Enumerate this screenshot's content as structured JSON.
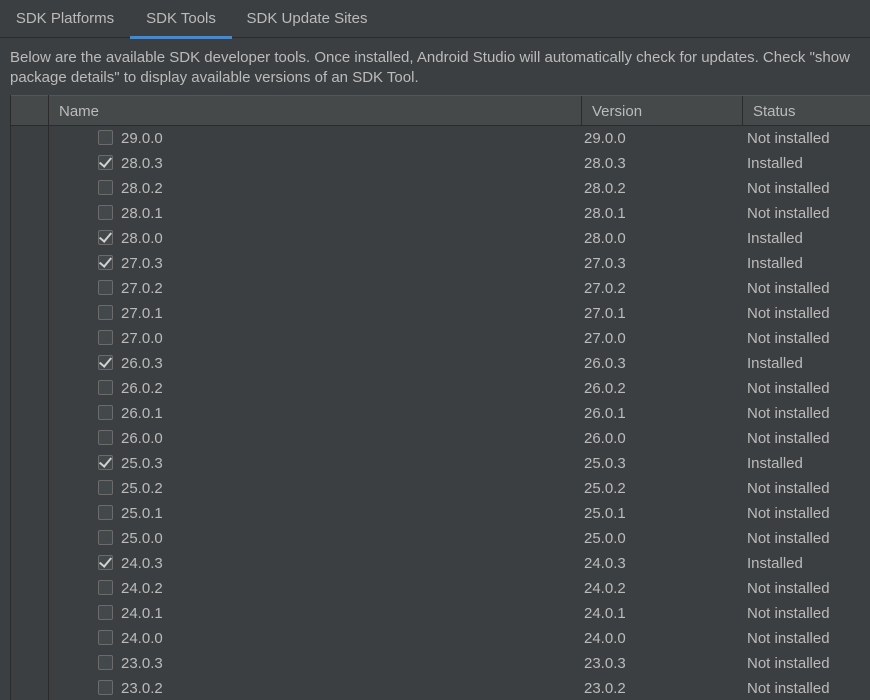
{
  "tabs": [
    {
      "label": "SDK Platforms",
      "active": false
    },
    {
      "label": "SDK Tools",
      "active": true
    },
    {
      "label": "SDK Update Sites",
      "active": false
    }
  ],
  "description": "Below are the available SDK developer tools. Once installed, Android Studio will automatically check for updates. Check \"show package details\" to display available versions of an SDK Tool.",
  "table": {
    "columns": {
      "name": "Name",
      "version": "Version",
      "status": "Status"
    },
    "rows": [
      {
        "name": "29.0.0",
        "version": "29.0.0",
        "status": "Not installed",
        "checked": false
      },
      {
        "name": "28.0.3",
        "version": "28.0.3",
        "status": "Installed",
        "checked": true
      },
      {
        "name": "28.0.2",
        "version": "28.0.2",
        "status": "Not installed",
        "checked": false
      },
      {
        "name": "28.0.1",
        "version": "28.0.1",
        "status": "Not installed",
        "checked": false
      },
      {
        "name": "28.0.0",
        "version": "28.0.0",
        "status": "Installed",
        "checked": true
      },
      {
        "name": "27.0.3",
        "version": "27.0.3",
        "status": "Installed",
        "checked": true
      },
      {
        "name": "27.0.2",
        "version": "27.0.2",
        "status": "Not installed",
        "checked": false
      },
      {
        "name": "27.0.1",
        "version": "27.0.1",
        "status": "Not installed",
        "checked": false
      },
      {
        "name": "27.0.0",
        "version": "27.0.0",
        "status": "Not installed",
        "checked": false
      },
      {
        "name": "26.0.3",
        "version": "26.0.3",
        "status": "Installed",
        "checked": true
      },
      {
        "name": "26.0.2",
        "version": "26.0.2",
        "status": "Not installed",
        "checked": false
      },
      {
        "name": "26.0.1",
        "version": "26.0.1",
        "status": "Not installed",
        "checked": false
      },
      {
        "name": "26.0.0",
        "version": "26.0.0",
        "status": "Not installed",
        "checked": false
      },
      {
        "name": "25.0.3",
        "version": "25.0.3",
        "status": "Installed",
        "checked": true
      },
      {
        "name": "25.0.2",
        "version": "25.0.2",
        "status": "Not installed",
        "checked": false
      },
      {
        "name": "25.0.1",
        "version": "25.0.1",
        "status": "Not installed",
        "checked": false
      },
      {
        "name": "25.0.0",
        "version": "25.0.0",
        "status": "Not installed",
        "checked": false
      },
      {
        "name": "24.0.3",
        "version": "24.0.3",
        "status": "Installed",
        "checked": true
      },
      {
        "name": "24.0.2",
        "version": "24.0.2",
        "status": "Not installed",
        "checked": false
      },
      {
        "name": "24.0.1",
        "version": "24.0.1",
        "status": "Not installed",
        "checked": false
      },
      {
        "name": "24.0.0",
        "version": "24.0.0",
        "status": "Not installed",
        "checked": false
      },
      {
        "name": "23.0.3",
        "version": "23.0.3",
        "status": "Not installed",
        "checked": false
      },
      {
        "name": "23.0.2",
        "version": "23.0.2",
        "status": "Not installed",
        "checked": false
      }
    ]
  },
  "colors": {
    "background": "#3c3f41",
    "header": "#45494a",
    "accent": "#4a88c7",
    "text": "#bbbbbb"
  }
}
